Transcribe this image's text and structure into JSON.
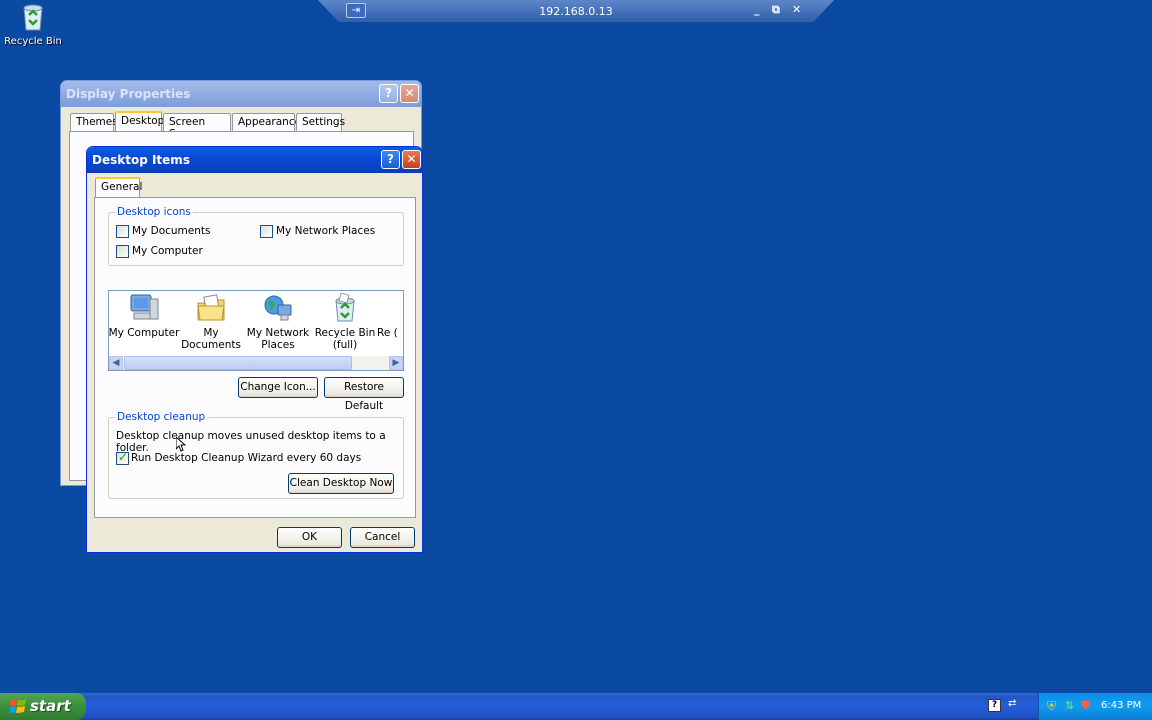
{
  "desktop": {
    "recycle_bin_label": "Recycle Bin"
  },
  "remote_bar": {
    "address": "192.168.0.13",
    "pin": "⇥",
    "minimize": "_",
    "restore": "⧉",
    "close": "✕"
  },
  "display_properties": {
    "title": "Display Properties",
    "tabs": [
      "Themes",
      "Desktop",
      "Screen Saver",
      "Appearance",
      "Settings"
    ],
    "active_tab": "Desktop"
  },
  "desktop_items": {
    "title": "Desktop Items",
    "help": "?",
    "close": "✕",
    "tab": "General",
    "desktop_icons_group": "Desktop icons",
    "checkboxes": {
      "my_documents": "My Documents",
      "my_network_places": "My Network Places",
      "my_computer": "My Computer"
    },
    "icons": [
      {
        "label": "My Computer",
        "icon": "my-computer-icon"
      },
      {
        "label": "My Documents",
        "icon": "my-documents-icon"
      },
      {
        "label": "My Network Places",
        "icon": "my-network-places-icon"
      },
      {
        "label": "Recycle Bin (full)",
        "icon": "recycle-bin-full-icon"
      },
      {
        "label": "Re (",
        "icon": "recycle-bin-empty-icon"
      }
    ],
    "change_icon": "Change Icon...",
    "restore_default": "Restore Default",
    "cleanup_group": "Desktop cleanup",
    "cleanup_text": "Desktop cleanup moves unused desktop items to a folder.",
    "cleanup_checkbox": "Run Desktop Cleanup Wizard every 60 days",
    "clean_now": "Clean Desktop Now",
    "ok": "OK",
    "cancel": "Cancel"
  },
  "taskbar": {
    "start": "start",
    "clock": "6:43 PM"
  },
  "colors": {
    "desktop": "#0a4aa3",
    "titlebar": "#0a49d3",
    "taskbar": "#245edb",
    "start": "#3c8f3c"
  }
}
